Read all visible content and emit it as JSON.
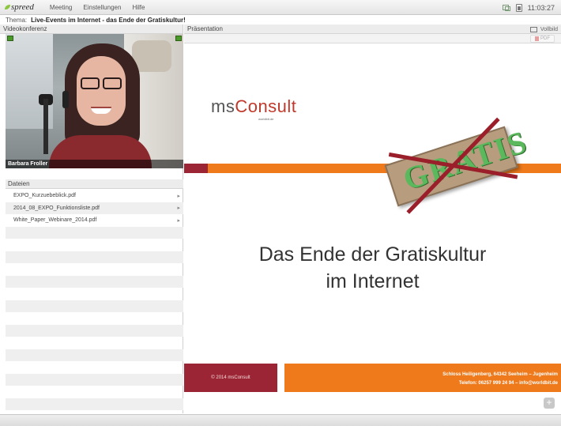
{
  "app": {
    "logo": "spreed",
    "time": "11:03:27"
  },
  "menu": [
    "Meeting",
    "Einstellungen",
    "Hilfe"
  ],
  "topic": {
    "label": "Thema:",
    "value": "Live-Events im Internet - das Ende der Gratiskultur!"
  },
  "video": {
    "header": "Videokonferenz",
    "participant": "Barbara Froller"
  },
  "files": {
    "header": "Dateien",
    "items": [
      "EXPO_Kurzuebeblick.pdf",
      "2014_08_EXPO_Funktionsliste.pdf",
      "White_Paper_Webinare_2014.pdf"
    ]
  },
  "presentation": {
    "header": "Präsentation",
    "fullscreen_label": "Vollbild",
    "pdf_label": "PDF",
    "slide": {
      "logo_ms": "ms",
      "logo_consult": "Consult",
      "logo_tagline": "worldbit.de",
      "stamp_text": "GRATIS",
      "headline_line1": "Das Ende der Gratiskultur",
      "headline_line2": "im Internet",
      "footer_left": "© 2014 msConsult",
      "footer_right_line1": "Schloss Heiligenberg, 64342 Seeheim – Jugenheim",
      "footer_right_line2": "Telefon: 06257 999 24 94 – info@worldbit.de"
    }
  },
  "colors": {
    "brand_red": "#9b2534",
    "brand_orange": "#ee7a1c",
    "stamp_green": "#5cb85c"
  }
}
